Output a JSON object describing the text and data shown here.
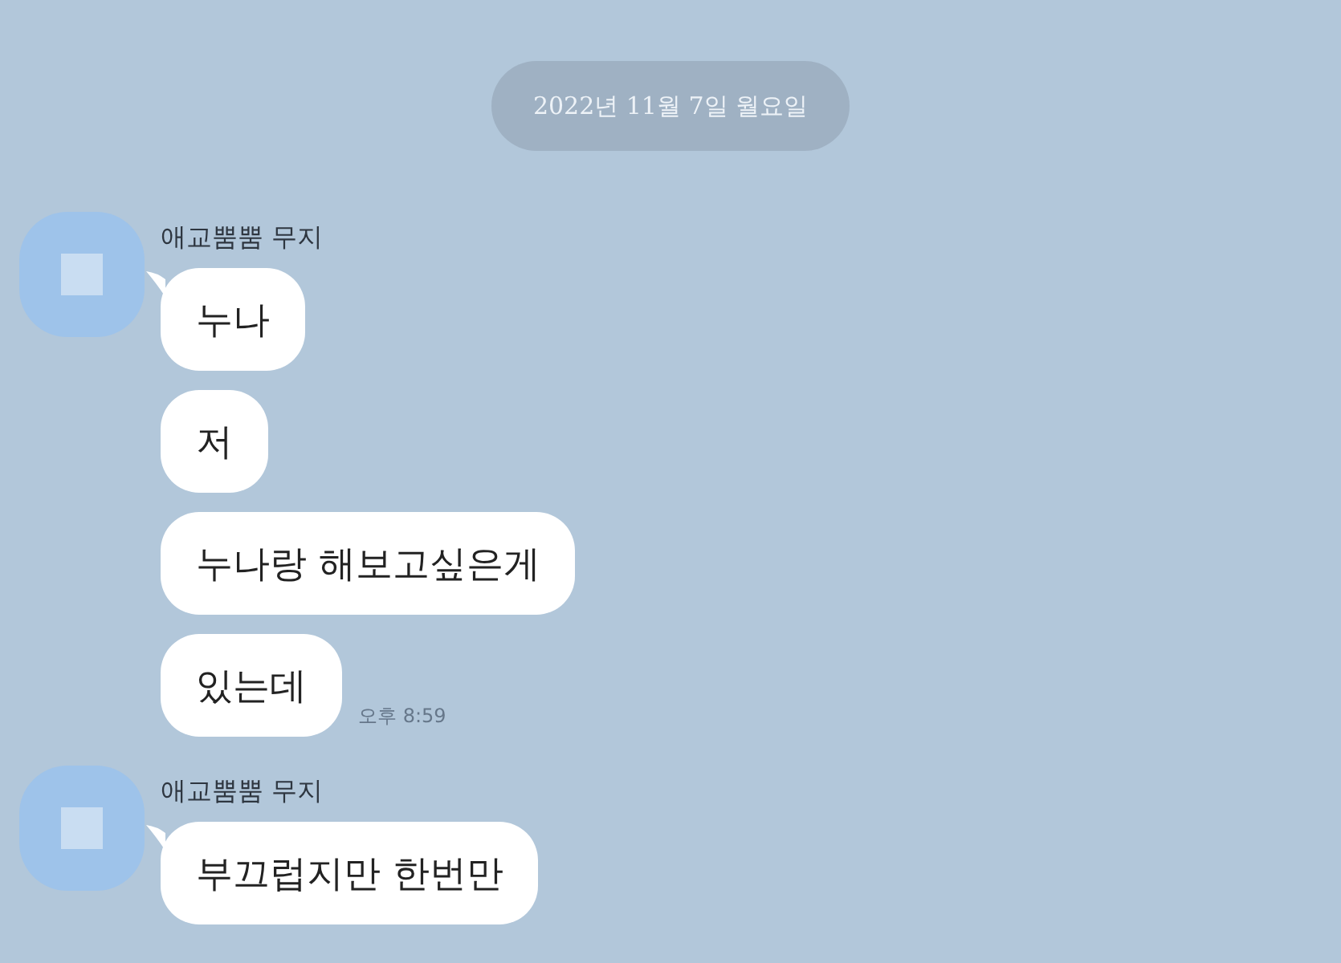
{
  "date_divider": "2022년 11월 7일 월요일",
  "message_groups": [
    {
      "sender": "애교뿜뿜 무지",
      "messages": [
        {
          "text": "누나"
        },
        {
          "text": "저"
        },
        {
          "text": "누나랑 해보고싶은게"
        },
        {
          "text": "있는데",
          "time": "오후 8:59"
        }
      ]
    },
    {
      "sender": "애교뿜뿜 무지",
      "messages": [
        {
          "text": "부끄럽지만 한번만"
        }
      ]
    }
  ]
}
